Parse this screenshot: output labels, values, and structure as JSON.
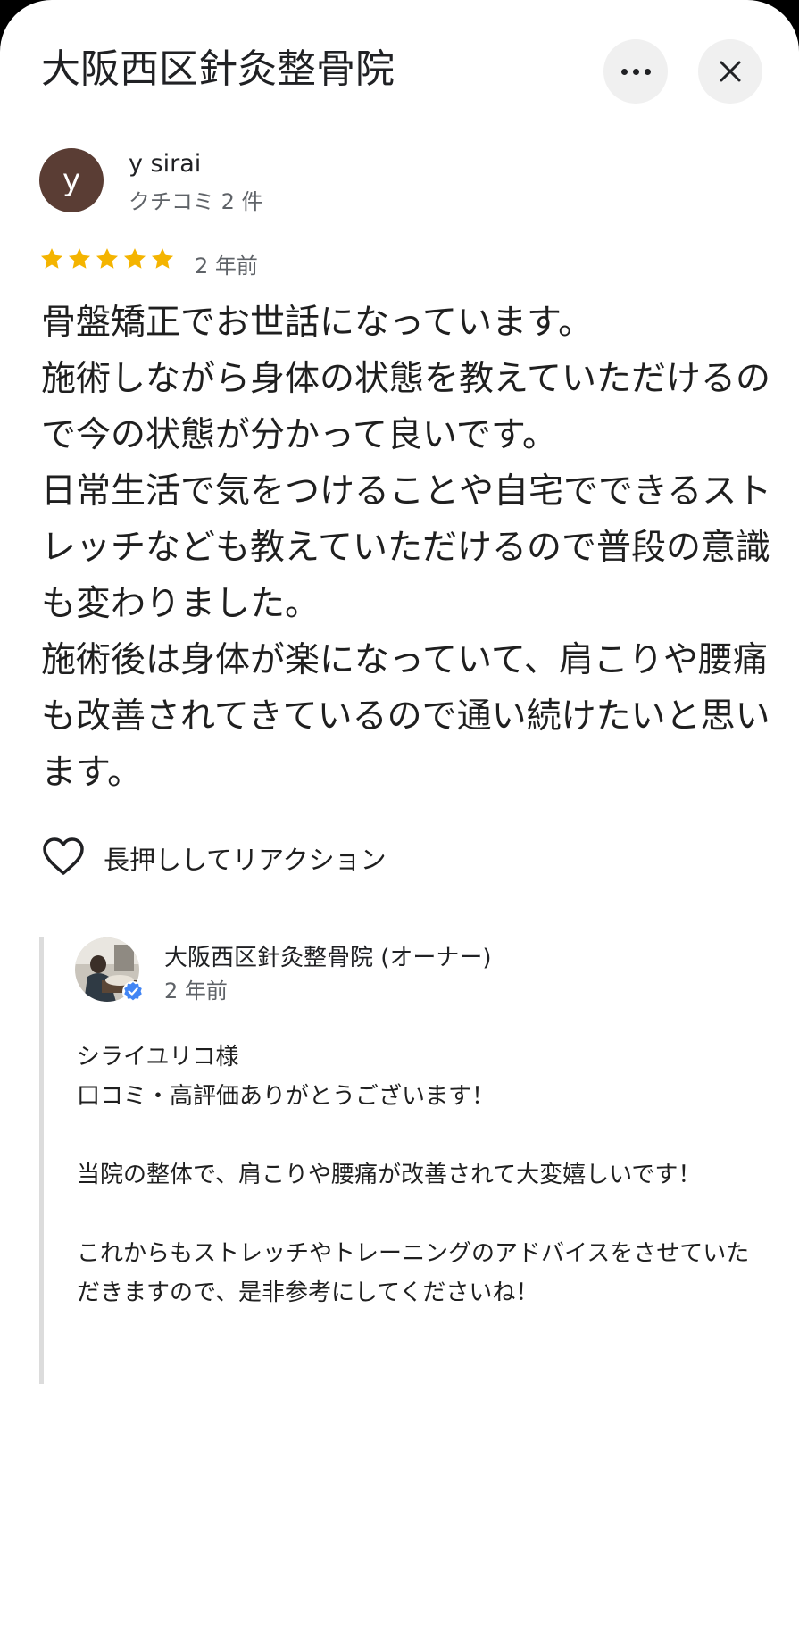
{
  "header": {
    "title": "大阪西区針灸整骨院",
    "more_icon": "more-horiz-icon",
    "close_icon": "close-icon",
    "close_glyph": "✕"
  },
  "review": {
    "avatar_initial": "y",
    "avatar_color": "#5a3d34",
    "reviewer_name": "y sirai",
    "reviewer_meta": "クチコミ 2 件",
    "rating": 5,
    "rating_max": 5,
    "star_color": "#f4b400",
    "time": "2 年前",
    "text": "骨盤矯正でお世話になっています。\n施術しながら身体の状態を教えていただけるので今の状態が分かって良いです。\n日常生活で気をつけることや自宅でできるストレッチなども教えていただけるので普段の意識も変わりました。\n施術後は身体が楽になっていて、肩こりや腰痛も改善されてきているので通い続けたいと思います。"
  },
  "reaction": {
    "icon": "heart-outline-icon",
    "label": "長押ししてリアクション"
  },
  "owner_reply": {
    "name": "大阪西区針灸整骨院 (オーナー)",
    "verified_icon": "verified-badge-icon",
    "verified_color": "#4285f4",
    "time": "2 年前",
    "text": "シライユリコ様\n口コミ・高評価ありがとうございます！\n\n当院の整体で、肩こりや腰痛が改善されて大変嬉しいです！\n\nこれからもストレッチやトレーニングのアドバイスをさせていただきますので、是非参考にしてくださいね！"
  }
}
